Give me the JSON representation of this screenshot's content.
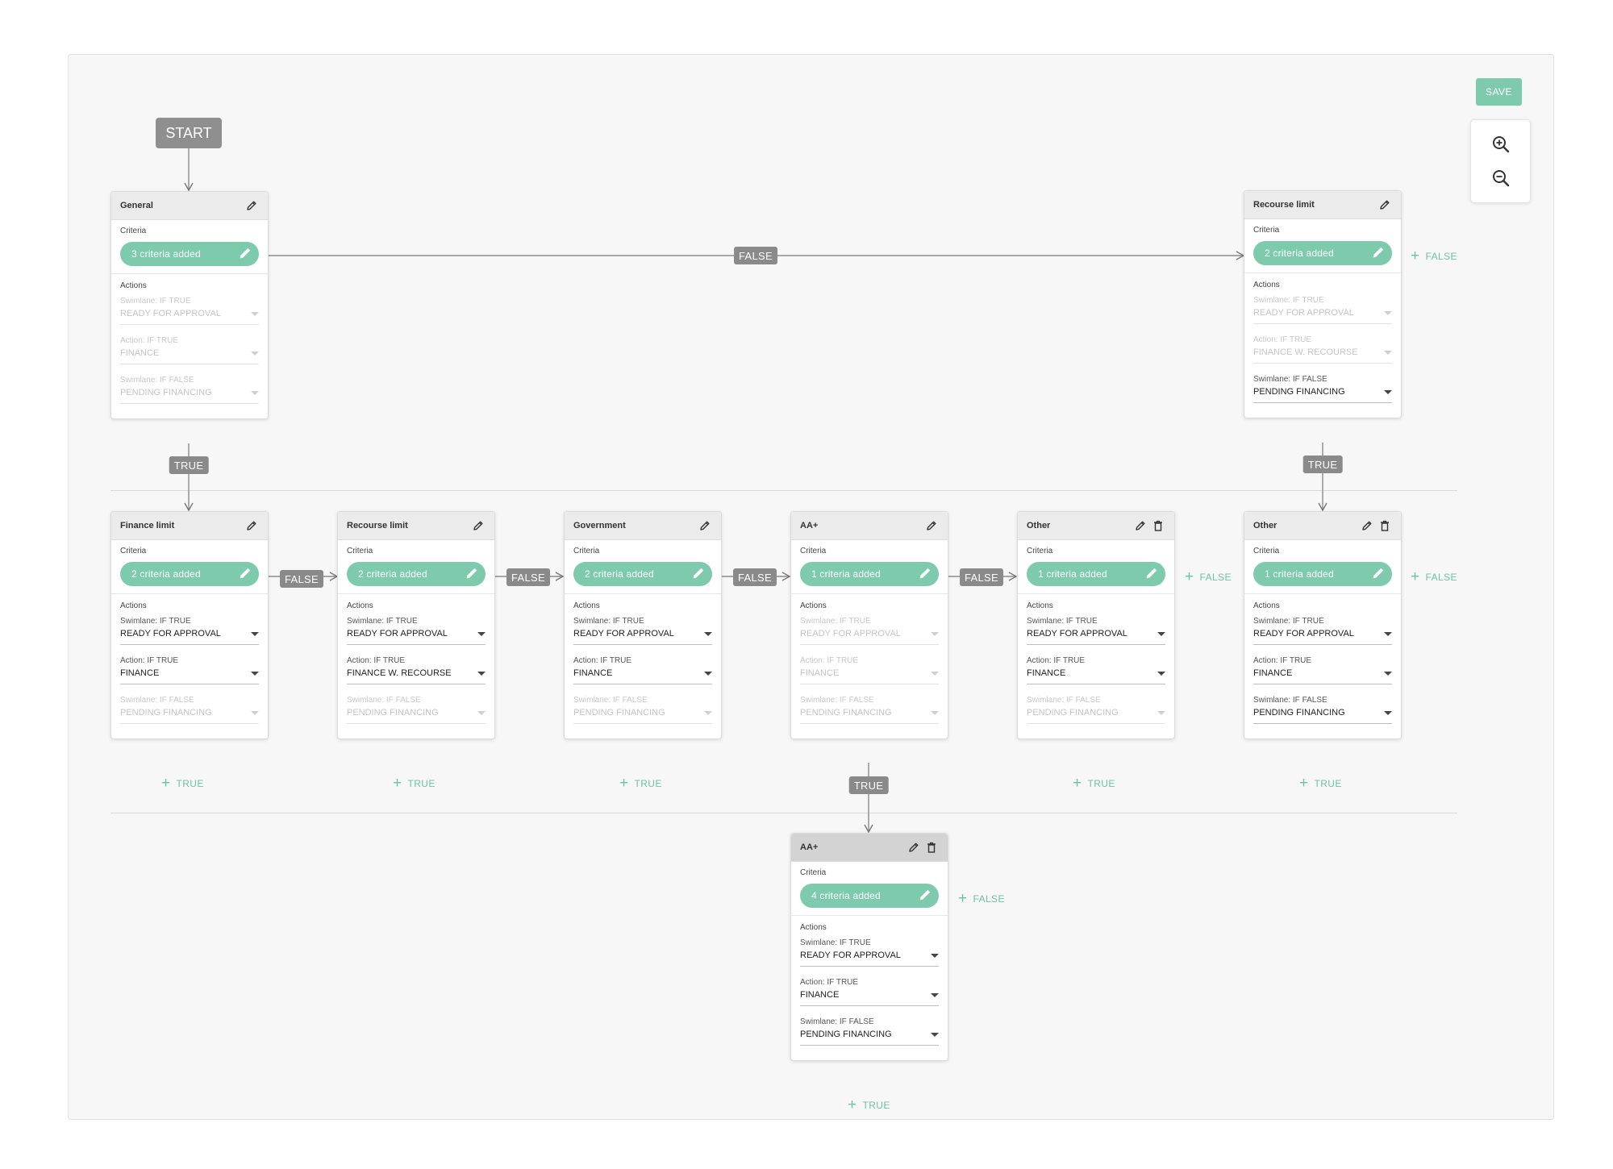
{
  "toolbar": {
    "save_label": "SAVE"
  },
  "start": {
    "label": "START"
  },
  "link_labels": {
    "true": "TRUE",
    "false": "FALSE"
  },
  "add_links": {
    "true": "TRUE",
    "false": "FALSE"
  },
  "colors": {
    "accent": "#7ecaad",
    "tag": "#8a8a8a",
    "canvas": "#f7f7f7"
  },
  "icons": [
    "zoom-in-icon",
    "zoom-out-icon",
    "pencil-icon",
    "trash-icon",
    "caret-down-icon",
    "plus-icon",
    "arrow-icon"
  ],
  "nodes": [
    {
      "title": "General",
      "criteria_label": "Criteria",
      "criteria_pill": "3 criteria added",
      "actions_label": "Actions",
      "fields": [
        {
          "label": "Swimlane: IF TRUE",
          "value": "READY FOR APPROVAL"
        },
        {
          "label": "Action: IF TRUE",
          "value": "FINANCE"
        },
        {
          "label": "Swimlane: IF FALSE",
          "value": "PENDING FINANCING"
        }
      ]
    },
    {
      "title": "Recourse limit",
      "criteria_label": "Criteria",
      "criteria_pill": "2 criteria added",
      "actions_label": "Actions",
      "fields": [
        {
          "label": "Swimlane: IF TRUE",
          "value": "READY FOR APPROVAL"
        },
        {
          "label": "Action: IF TRUE",
          "value": "FINANCE W. RECOURSE"
        },
        {
          "label": "Swimlane: IF FALSE",
          "value": "PENDING FINANCING"
        }
      ]
    },
    {
      "title": "Finance limit",
      "criteria_label": "Criteria",
      "criteria_pill": "2 criteria added",
      "actions_label": "Actions",
      "fields": [
        {
          "label": "Swimlane: IF TRUE",
          "value": "READY FOR APPROVAL"
        },
        {
          "label": "Action: IF TRUE",
          "value": "FINANCE"
        },
        {
          "label": "Swimlane: IF FALSE",
          "value": "PENDING FINANCING"
        }
      ]
    },
    {
      "title": "Recourse limit",
      "criteria_label": "Criteria",
      "criteria_pill": "2 criteria added",
      "actions_label": "Actions",
      "fields": [
        {
          "label": "Swimlane: IF TRUE",
          "value": "READY FOR APPROVAL"
        },
        {
          "label": "Action: IF TRUE",
          "value": "FINANCE W. RECOURSE"
        },
        {
          "label": "Swimlane: IF FALSE",
          "value": "PENDING FINANCING"
        }
      ]
    },
    {
      "title": "Government",
      "criteria_label": "Criteria",
      "criteria_pill": "2 criteria added",
      "actions_label": "Actions",
      "fields": [
        {
          "label": "Swimlane: IF TRUE",
          "value": "READY FOR APPROVAL"
        },
        {
          "label": "Action: IF TRUE",
          "value": "FINANCE"
        },
        {
          "label": "Swimlane: IF FALSE",
          "value": "PENDING FINANCING"
        }
      ]
    },
    {
      "title": "AA+",
      "criteria_label": "Criteria",
      "criteria_pill": "1 criteria added",
      "actions_label": "Actions",
      "fields": [
        {
          "label": "Swimlane: IF TRUE",
          "value": "READY FOR APPROVAL"
        },
        {
          "label": "Action: IF TRUE",
          "value": "FINANCE"
        },
        {
          "label": "Swimlane: IF FALSE",
          "value": "PENDING FINANCING"
        }
      ]
    },
    {
      "title": "Other",
      "criteria_label": "Criteria",
      "criteria_pill": "1 criteria added",
      "actions_label": "Actions",
      "fields": [
        {
          "label": "Swimlane: IF TRUE",
          "value": "READY FOR APPROVAL"
        },
        {
          "label": "Action: IF TRUE",
          "value": "FINANCE"
        },
        {
          "label": "Swimlane: IF FALSE",
          "value": "PENDING FINANCING"
        }
      ]
    },
    {
      "title": "Other",
      "criteria_label": "Criteria",
      "criteria_pill": "1 criteria added",
      "actions_label": "Actions",
      "fields": [
        {
          "label": "Swimlane: IF TRUE",
          "value": "READY FOR APPROVAL"
        },
        {
          "label": "Action: IF TRUE",
          "value": "FINANCE"
        },
        {
          "label": "Swimlane: IF FALSE",
          "value": "PENDING FINANCING"
        }
      ]
    },
    {
      "title": "AA+",
      "criteria_label": "Criteria",
      "criteria_pill": "4 criteria added",
      "actions_label": "Actions",
      "fields": [
        {
          "label": "Swimlane: IF TRUE",
          "value": "READY FOR APPROVAL"
        },
        {
          "label": "Action: IF TRUE",
          "value": "FINANCE"
        },
        {
          "label": "Swimlane: IF FALSE",
          "value": "PENDING FINANCING"
        }
      ]
    }
  ]
}
